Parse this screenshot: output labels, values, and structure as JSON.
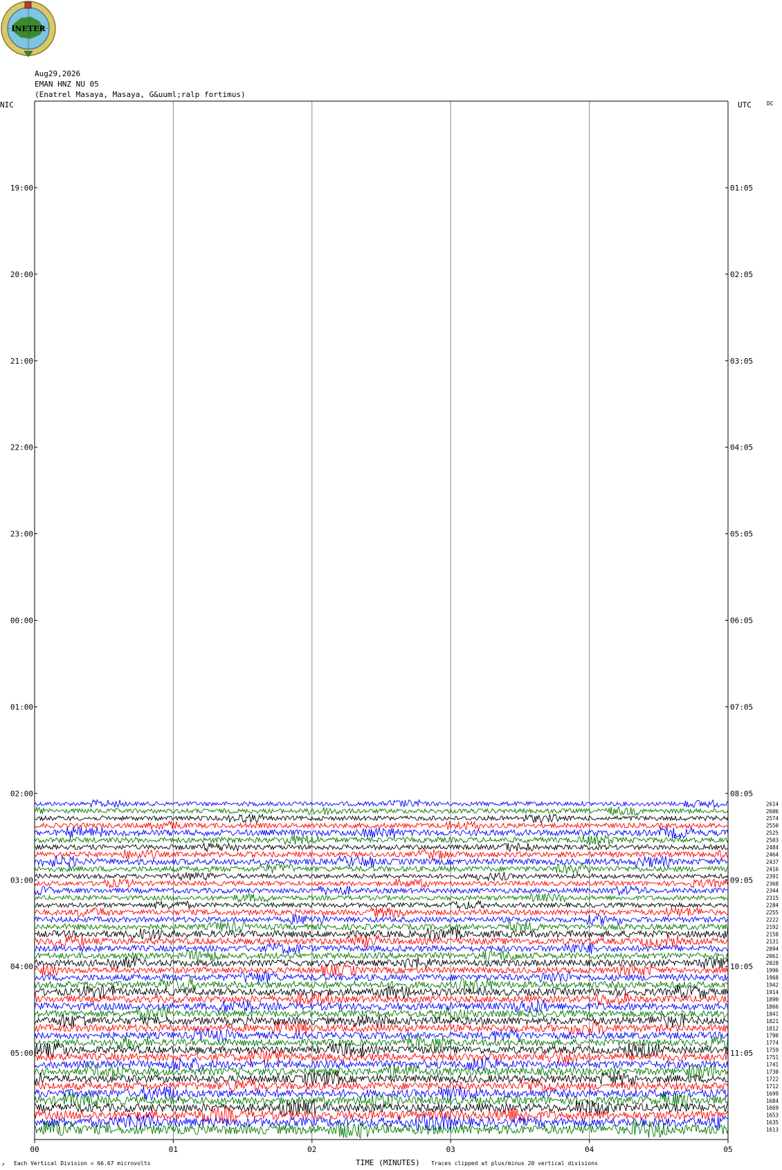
{
  "header": {
    "date": "Aug29,2026",
    "station": "EMAN HNZ NU 05",
    "location": "(Enatrel Masaya, Masaya, G&uuml;ralp fortimus)",
    "logo_text": "INETER",
    "left_tz": "NIC",
    "right_tz": "UTC",
    "dc_label": "DC"
  },
  "footer": {
    "scale_text": "Each Vertical Division =   66.67 microvolts",
    "xlabel": "TIME (MINUTES)",
    "clip_text": "Traces clipped at plus/minus 20 vertical divisions",
    "corner_mark": "↗"
  },
  "colors": {
    "trace_cycle": [
      "#0000ff",
      "#007700",
      "#000000",
      "#ff0000"
    ],
    "grid": "#888888",
    "frame": "#000000",
    "logo_outer": "#d9c86a",
    "logo_globe": "#7fc4e0",
    "logo_land": "#3b8a2e"
  },
  "chart_data": {
    "type": "helicorder",
    "x_ticks": [
      "00",
      "01",
      "02",
      "03",
      "04",
      "05"
    ],
    "xlim": [
      0,
      5
    ],
    "left_hour_labels": [
      "19:00",
      "20:00",
      "21:00",
      "22:00",
      "23:00",
      "00:00",
      "01:00",
      "02:00",
      "03:00",
      "04:00",
      "05:00"
    ],
    "right_hour_labels": [
      "01:05",
      "02:05",
      "03:05",
      "04:05",
      "05:05",
      "06:05",
      "07:05",
      "08:05",
      "09:05",
      "10:05",
      "11:05"
    ],
    "first_label_row": 1,
    "total_rows": 12,
    "data_start_row": 8.12,
    "trace_count_labels": [
      "2614",
      "2606",
      "2574",
      "2550",
      "2525",
      "2503",
      "2484",
      "2464",
      "2437",
      "2416",
      "2391",
      "2368",
      "2344",
      "2315",
      "2284",
      "2255",
      "2222",
      "2192",
      "2158",
      "2131",
      "2094",
      "2061",
      "2028",
      "1996",
      "1968",
      "1942",
      "1914",
      "1890",
      "1866",
      "1841",
      "1821",
      "1812",
      "1790",
      "1774",
      "1759",
      "1751",
      "1741",
      "1730",
      "1722",
      "1712",
      "1699",
      "1684",
      "1669",
      "1653",
      "1635",
      "1613"
    ],
    "trace_amplitude_relative": [
      0.55,
      0.6,
      0.6,
      0.65,
      0.8,
      0.7,
      0.65,
      0.7,
      0.8,
      0.7,
      0.6,
      0.6,
      0.65,
      0.6,
      0.6,
      0.7,
      0.7,
      0.75,
      0.9,
      0.85,
      0.8,
      0.8,
      0.85,
      0.8,
      0.85,
      0.9,
      0.95,
      0.9,
      0.95,
      0.9,
      1.0,
      0.95,
      0.9,
      0.9,
      1.0,
      1.0,
      1.0,
      1.0,
      1.0,
      1.0,
      1.05,
      1.05,
      1.1,
      1.15,
      1.2,
      1.25
    ]
  }
}
